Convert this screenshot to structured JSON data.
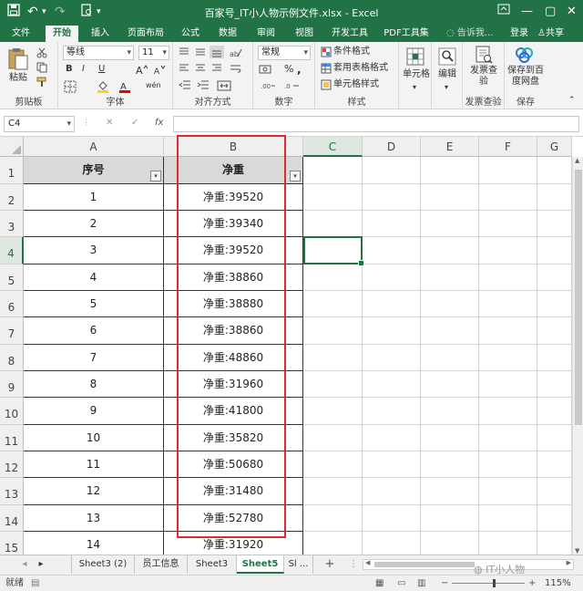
{
  "window": {
    "title": "百家号_IT小人物示例文件.xlsx - Excel",
    "minimize": "—",
    "restore": "▢",
    "close": "✕"
  },
  "ribbon_tabs": [
    "文件",
    "开始",
    "插入",
    "页面布局",
    "公式",
    "数据",
    "审阅",
    "视图",
    "开发工具",
    "PDF工具集"
  ],
  "active_tab": "开始",
  "tell_me": "告诉我...",
  "login": "登录",
  "share": "共享",
  "ribbon": {
    "clipboard": {
      "paste": "粘贴",
      "label": "剪贴板"
    },
    "font": {
      "name": "等线",
      "size": "11",
      "bold": "B",
      "italic": "I",
      "underline": "U",
      "label": "字体",
      "wen": "wén"
    },
    "alignment": {
      "label": "对齐方式"
    },
    "number": {
      "format": "常规",
      "label": "数字"
    },
    "styles": {
      "conditional": "条件格式",
      "table": "套用表格格式",
      "cell": "单元格样式",
      "label": "样式"
    },
    "cells": {
      "label": "单元格"
    },
    "editing": {
      "label": "编辑"
    },
    "invoice": {
      "check": "发票查验",
      "label": "发票查验"
    },
    "save": {
      "button": "保存到百度网盘",
      "label": "保存"
    }
  },
  "formula_bar": {
    "name_box": "C4",
    "fx": "fx",
    "cancel": "✕",
    "enter": "✓",
    "value": ""
  },
  "columns": [
    "A",
    "B",
    "C",
    "D",
    "E",
    "F",
    "G"
  ],
  "rows": [
    "1",
    "2",
    "3",
    "4",
    "5",
    "6",
    "7",
    "8",
    "9",
    "10",
    "11",
    "12",
    "13",
    "14",
    "15"
  ],
  "table": {
    "headers": [
      "序号",
      "净重"
    ],
    "data": [
      [
        "1",
        "净重:39520"
      ],
      [
        "2",
        "净重:39340"
      ],
      [
        "3",
        "净重:39520"
      ],
      [
        "4",
        "净重:38860"
      ],
      [
        "5",
        "净重:38880"
      ],
      [
        "6",
        "净重:38860"
      ],
      [
        "7",
        "净重:48860"
      ],
      [
        "8",
        "净重:31960"
      ],
      [
        "9",
        "净重:41800"
      ],
      [
        "10",
        "净重:35820"
      ],
      [
        "11",
        "净重:50680"
      ],
      [
        "12",
        "净重:31480"
      ],
      [
        "13",
        "净重:52780"
      ],
      [
        "14",
        "净重:31920"
      ]
    ]
  },
  "sheet_tabs": [
    "Sheet3 (2)",
    "员工信息",
    "Sheet3",
    "Sheet5",
    "Sl ..."
  ],
  "active_sheet": "Sheet5",
  "add_sheet": "+",
  "status": {
    "mode": "就绪",
    "zoom": "115%",
    "watermark": "IT小人物"
  },
  "colors": {
    "excel_green": "#217346",
    "highlight_red": "#e0282f",
    "header_fill": "#d9d9d9"
  }
}
